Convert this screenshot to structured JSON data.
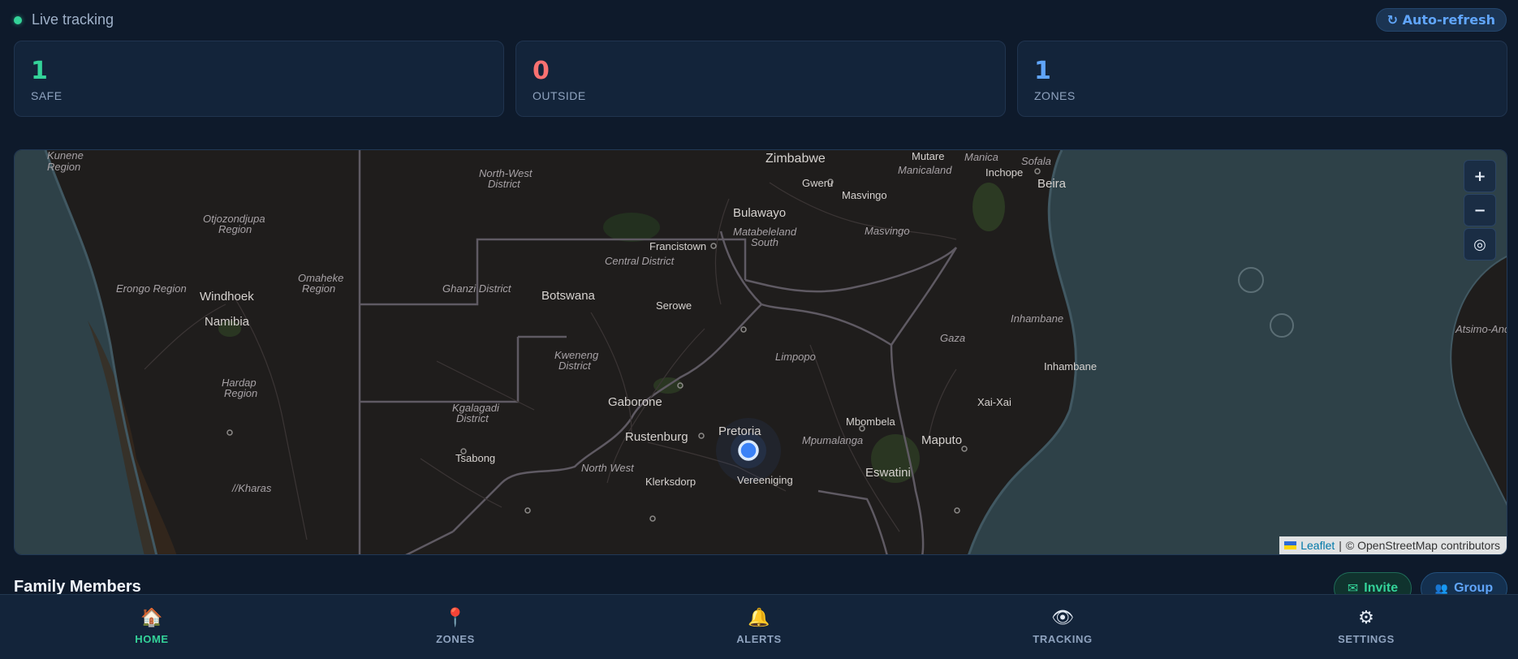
{
  "header": {
    "status_text": "Live tracking",
    "refresh_label": "↻ Auto-refresh"
  },
  "stats": [
    {
      "value": "1",
      "label": "SAFE",
      "color": "#34d399"
    },
    {
      "value": "0",
      "label": "OUTSIDE",
      "color": "#f87171"
    },
    {
      "value": "1",
      "label": "ZONES",
      "color": "#60a5fa"
    }
  ],
  "map": {
    "controls": {
      "zoom_in": "+",
      "zoom_out": "−",
      "locate": "◎"
    },
    "attribution": {
      "leaflet": "Leaflet",
      "separator": "|",
      "osm": "© OpenStreetMap contributors"
    },
    "labels": {
      "zimbabwe": "Zimbabwe",
      "mutare": "Mutare",
      "manica": "Manica",
      "sofala": "Sofala",
      "manicaland": "Manicaland",
      "chinhoyi": "Inchope",
      "beira": "Beira",
      "gweru": "Gweru",
      "masvingo": "Masvingo",
      "masvingo_prov": "Masvingo",
      "bulawayo": "Bulawayo",
      "matabeleland": "Matabeleland",
      "matabeleland2": "South",
      "francistown": "Francistown",
      "central": "Central District",
      "nw1": "North-West",
      "nw2": "District",
      "kunene1": "Kunene",
      "kunene2": "Region",
      "otj1": "Otjozondjupa",
      "otj2": "Region",
      "erongo": "Erongo Region",
      "windhoek": "Windhoek",
      "namibia": "Namibia",
      "omaheke1": "Omaheke",
      "omaheke2": "Region",
      "ghanzi": "Ghanzi District",
      "botswana": "Botswana",
      "serowe": "Serowe",
      "inhambane_prov": "Inhambane",
      "inhambane": "Inhambane",
      "gaza": "Gaza",
      "kweneng1": "Kweneng",
      "kweneng2": "District",
      "limpopo": "Limpopo",
      "hardap1": "Hardap",
      "hardap2": "Region",
      "gaborone": "Gaborone",
      "xaixai": "Xai-Xai",
      "kgalagadi1": "Kgalagadi",
      "kgalagadi2": "District",
      "pretoria": "Pretoria",
      "mbombela": "Mbombela",
      "rustenburg": "Rustenburg",
      "mpumalanga": "Mpumalanga",
      "maputo": "Maputo",
      "tsabong": "Tsabong",
      "northwest": "North West",
      "eswatini": "Eswatini",
      "klerksdorp": "Klerksdorp",
      "vereeniging": "Vereeniging",
      "karas": "//Kharas",
      "atsimo": "Atsimo-Andr"
    }
  },
  "members": {
    "title": "Family Members",
    "invite_label": "Invite",
    "group_label": "Group"
  },
  "nav": [
    {
      "icon": "🏠",
      "label": "HOME",
      "active": true
    },
    {
      "icon": "📍",
      "label": "ZONES",
      "active": false
    },
    {
      "icon": "🔔",
      "label": "ALERTS",
      "active": false
    },
    {
      "icon": "👁",
      "label": "TRACKING",
      "active": false
    },
    {
      "icon": "⚙",
      "label": "SETTINGS",
      "active": false
    }
  ]
}
